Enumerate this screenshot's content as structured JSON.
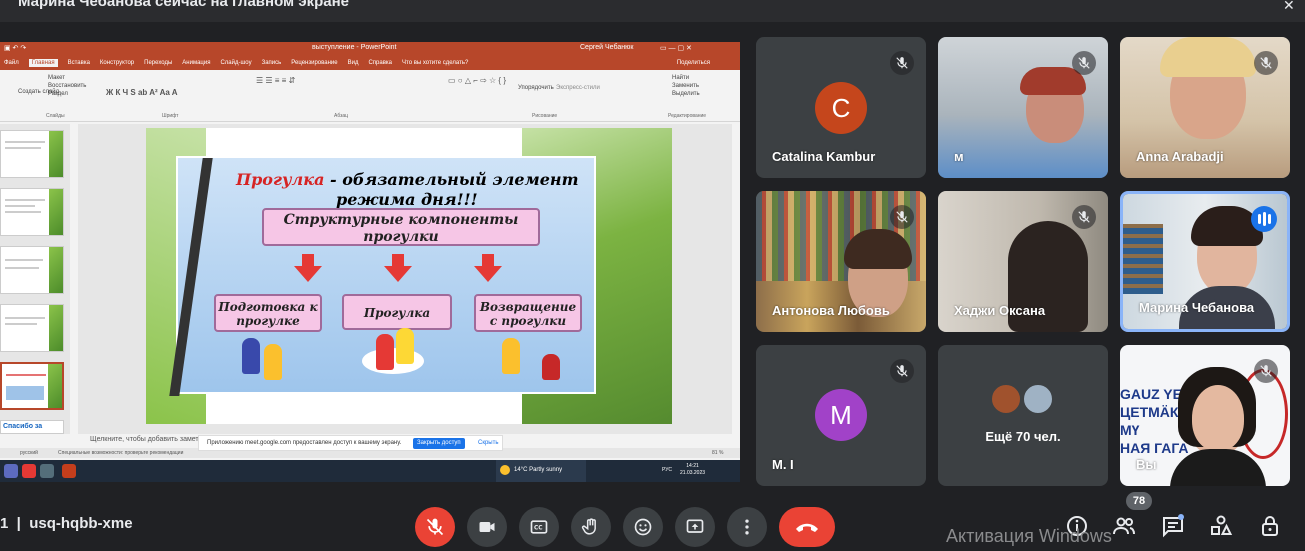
{
  "header": {
    "presenting_text": "Марина Чебанова сейчас на главном экране"
  },
  "shared_screen": {
    "window_title": "выступление - PowerPoint",
    "user": "Сергей Чебанюк",
    "ribbon_tabs": [
      "Файл",
      "Главная",
      "Вставка",
      "Конструктор",
      "Переходы",
      "Анимация",
      "Слайд-шоу",
      "Запись",
      "Рецензирование",
      "Вид",
      "Справка",
      "Что вы хотите сделать?"
    ],
    "ribbon_share": "Поделиться",
    "ribbon": {
      "new_slide": "Создать слайд",
      "paste_items": [
        "Макет",
        "Восстановить",
        "Раздел"
      ],
      "groups": [
        "Слайды",
        "Шрифт",
        "Абзац",
        "Рисование",
        "Редактирование"
      ],
      "arrange": "Упорядочить",
      "express": "Экспресс-стили",
      "find": "Найти",
      "replace": "Заменить",
      "select": "Выделить"
    },
    "slide": {
      "title_red": "Прогулка",
      "title_rest": " - обязательный элемент",
      "title_line2": "режима дня!!!",
      "structure": "Структурные компоненты прогулки",
      "box_prep": "Подготовка к прогулке",
      "box_walk": "Прогулка",
      "box_return": "Возвращение с прогулки"
    },
    "notes_placeholder": "Щелкните, чтобы добавить заметки",
    "thumb_last_text": "Спасибо за",
    "status_lang": "русский",
    "status_access": "Специальные возможности: проверьте рекомендации",
    "status_zoom": "81 %",
    "share_banner": {
      "message": "Приложению meet.google.com предоставлен доступ к вашему экрану.",
      "stop_label": "Закрыть доступ",
      "hide_label": "Скрыть"
    },
    "taskbar": {
      "weather": "14°C  Partly sunny",
      "lang": "РУС",
      "time": "14:21",
      "date": "21.03.2023"
    }
  },
  "participants": [
    {
      "name": "Catalina Kambur",
      "initial": "C",
      "avatar_color": "#c5461c",
      "muted": true
    },
    {
      "name": "м",
      "muted": true
    },
    {
      "name": "Anna Arabadji",
      "muted": true
    },
    {
      "name": "Антонова Любовь",
      "muted": true
    },
    {
      "name": "Хаджи Оксана",
      "muted": true
    },
    {
      "name": "Марина Чебанова",
      "muted": false,
      "speaking": true
    },
    {
      "name": "М. I",
      "initial": "M",
      "avatar_color": "#a142c8",
      "muted": true
    },
    {
      "name": "Ещё 70 чел.",
      "muted": false
    },
    {
      "name": "Вы",
      "muted": true
    }
  ],
  "bottom": {
    "meeting_code": "usq-hqbb-xme",
    "prefix": "1",
    "participant_count": "78",
    "watermark": "Активация Windows"
  },
  "colors": {
    "end_call": "#ea4335",
    "accent": "#1a73e8",
    "tile_bg": "#3c4043",
    "page_bg": "#202124"
  }
}
